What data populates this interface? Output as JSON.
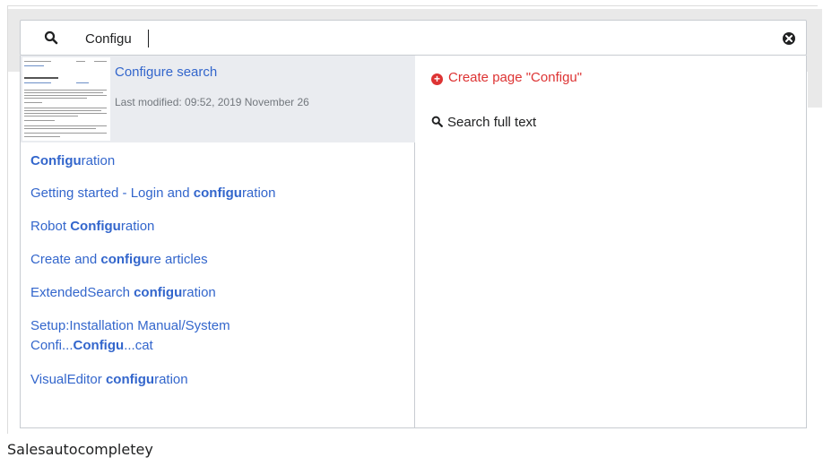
{
  "search": {
    "value": "Configu"
  },
  "featured": {
    "title": "Configure search",
    "meta": "Last modified: 09:52, 2019 November 26"
  },
  "results": [
    {
      "parts": [
        {
          "t": "Configu",
          "b": true
        },
        {
          "t": "ration",
          "b": false
        }
      ]
    },
    {
      "parts": [
        {
          "t": "Getting started - Login and ",
          "b": false
        },
        {
          "t": "configu",
          "b": true
        },
        {
          "t": "ration",
          "b": false
        }
      ]
    },
    {
      "parts": [
        {
          "t": "Robot ",
          "b": false
        },
        {
          "t": "Configu",
          "b": true
        },
        {
          "t": "ration",
          "b": false
        }
      ]
    },
    {
      "parts": [
        {
          "t": "Create and ",
          "b": false
        },
        {
          "t": "configu",
          "b": true
        },
        {
          "t": "re articles",
          "b": false
        }
      ]
    },
    {
      "parts": [
        {
          "t": "ExtendedSearch ",
          "b": false
        },
        {
          "t": "configu",
          "b": true
        },
        {
          "t": "ration",
          "b": false
        }
      ]
    },
    {
      "parts": [
        {
          "t": "Setup:Installation Manual/System",
          "b": false
        },
        {
          "t": "\n",
          "b": false
        },
        {
          "t": "Confi...",
          "b": false
        },
        {
          "t": "Configu",
          "b": true
        },
        {
          "t": "...cat",
          "b": false
        }
      ]
    },
    {
      "parts": [
        {
          "t": "VisualEditor ",
          "b": false
        },
        {
          "t": "configu",
          "b": true
        },
        {
          "t": "ration",
          "b": false
        }
      ]
    }
  ],
  "actions": {
    "create": "Create page \"Configu\"",
    "fulltext": "Search full text"
  },
  "caption": "Salesautocompletey",
  "colors": {
    "link": "#3366cc",
    "create": "#dd3333",
    "highlight_bg": "#eaecf0"
  }
}
